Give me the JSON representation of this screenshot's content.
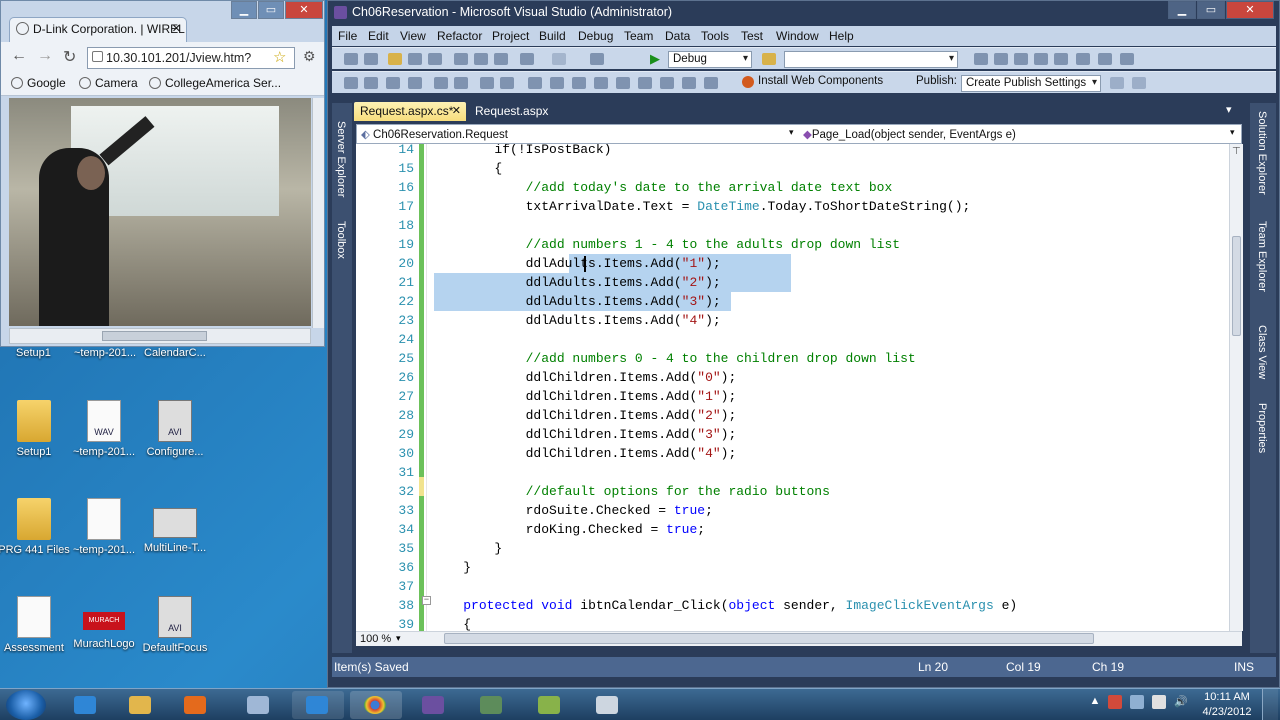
{
  "desktop": {
    "top_partial_labels": [
      "Setup1",
      "~temp-201...",
      "CalendarC..."
    ],
    "icons": [
      {
        "label": "Setup1",
        "icon": "folder-icon"
      },
      {
        "label": "~temp-201...",
        "icon": "wav-file-icon",
        "badge": "WAV"
      },
      {
        "label": "Configure...",
        "icon": "avi-file-icon",
        "badge": "AVI"
      },
      {
        "label": "PRG 441 Files",
        "icon": "folder-icon"
      },
      {
        "label": "~temp-201...",
        "icon": "file-icon"
      },
      {
        "label": "MultiLine-T...",
        "icon": "video-file-icon"
      },
      {
        "label": "Assessment",
        "icon": "document-icon"
      },
      {
        "label": "MurachLogo",
        "icon": "image-icon",
        "badge": "MURACH"
      },
      {
        "label": "DefaultFocus",
        "icon": "avi-file-icon",
        "badge": "AVI"
      }
    ]
  },
  "chrome": {
    "tab_title": "D-Link Corporation. | WIREL",
    "url": "10.30.101.201/Jview.htm?",
    "bookmarks": [
      "Google",
      "Camera",
      "CollegeAmerica Ser..."
    ]
  },
  "vs": {
    "window_title": "Ch06Reservation - Microsoft Visual Studio (Administrator)",
    "menu": [
      "File",
      "Edit",
      "View",
      "Refactor",
      "Project",
      "Build",
      "Debug",
      "Team",
      "Data",
      "Tools",
      "Test",
      "Window",
      "Help"
    ],
    "config_combo": "Debug",
    "install_label": "Install Web Components",
    "publish_label": "Publish:",
    "publish_combo": "Create Publish Settings",
    "tabs": [
      "Request.aspx.cs*",
      "Request.aspx"
    ],
    "left_panels": [
      "Server Explorer",
      "Toolbox"
    ],
    "right_panels": [
      "Solution Explorer",
      "Team Explorer",
      "Class View",
      "Properties"
    ],
    "nav_class": "Ch06Reservation.Request",
    "nav_member": "Page_Load(object sender, EventArgs e)",
    "zoom": "100 %",
    "code_lines": [
      {
        "n": "14",
        "indent": 8,
        "parts": [
          [
            "if(!IsPostBack)",
            "pl"
          ]
        ]
      },
      {
        "n": "15",
        "indent": 8,
        "parts": [
          [
            "{",
            "pl"
          ]
        ]
      },
      {
        "n": "16",
        "indent": 12,
        "parts": [
          [
            "//add today's date to the arrival date text box",
            "cm"
          ]
        ]
      },
      {
        "n": "17",
        "indent": 12,
        "parts": [
          [
            "txtArrivalDate.Text = ",
            "pl"
          ],
          [
            "DateTime",
            "ty"
          ],
          [
            ".Today.ToShortDateString();",
            "pl"
          ]
        ]
      },
      {
        "n": "18",
        "indent": 0,
        "parts": []
      },
      {
        "n": "19",
        "indent": 12,
        "parts": [
          [
            "//add numbers 1 - 4 to the adults drop down list",
            "cm"
          ]
        ]
      },
      {
        "n": "20",
        "indent": 12,
        "parts": [
          [
            "ddlAdults.Items.Add(",
            "pl"
          ],
          [
            "\"1\"",
            "st"
          ],
          [
            ");",
            "pl"
          ]
        ]
      },
      {
        "n": "21",
        "indent": 12,
        "parts": [
          [
            "ddlAdults.Items.Add(",
            "pl"
          ],
          [
            "\"2\"",
            "st"
          ],
          [
            ");",
            "pl"
          ]
        ]
      },
      {
        "n": "22",
        "indent": 12,
        "parts": [
          [
            "ddlAdults.Items.Add(",
            "pl"
          ],
          [
            "\"3\"",
            "st"
          ],
          [
            ");",
            "pl"
          ]
        ]
      },
      {
        "n": "23",
        "indent": 12,
        "parts": [
          [
            "ddlAdults.Items.Add(",
            "pl"
          ],
          [
            "\"4\"",
            "st"
          ],
          [
            ");",
            "pl"
          ]
        ]
      },
      {
        "n": "24",
        "indent": 0,
        "parts": []
      },
      {
        "n": "25",
        "indent": 12,
        "parts": [
          [
            "//add numbers 0 - 4 to the children drop down list",
            "cm"
          ]
        ]
      },
      {
        "n": "26",
        "indent": 12,
        "parts": [
          [
            "ddlChildren.Items.Add(",
            "pl"
          ],
          [
            "\"0\"",
            "st"
          ],
          [
            ");",
            "pl"
          ]
        ]
      },
      {
        "n": "27",
        "indent": 12,
        "parts": [
          [
            "ddlChildren.Items.Add(",
            "pl"
          ],
          [
            "\"1\"",
            "st"
          ],
          [
            ");",
            "pl"
          ]
        ]
      },
      {
        "n": "28",
        "indent": 12,
        "parts": [
          [
            "ddlChildren.Items.Add(",
            "pl"
          ],
          [
            "\"2\"",
            "st"
          ],
          [
            ");",
            "pl"
          ]
        ]
      },
      {
        "n": "29",
        "indent": 12,
        "parts": [
          [
            "ddlChildren.Items.Add(",
            "pl"
          ],
          [
            "\"3\"",
            "st"
          ],
          [
            ");",
            "pl"
          ]
        ]
      },
      {
        "n": "30",
        "indent": 12,
        "parts": [
          [
            "ddlChildren.Items.Add(",
            "pl"
          ],
          [
            "\"4\"",
            "st"
          ],
          [
            ");",
            "pl"
          ]
        ]
      },
      {
        "n": "31",
        "indent": 0,
        "parts": []
      },
      {
        "n": "32",
        "indent": 12,
        "parts": [
          [
            "//default options for the radio buttons",
            "cm"
          ]
        ]
      },
      {
        "n": "33",
        "indent": 12,
        "parts": [
          [
            "rdoSuite.Checked = ",
            "pl"
          ],
          [
            "true",
            "kw"
          ],
          [
            ";",
            "pl"
          ]
        ]
      },
      {
        "n": "34",
        "indent": 12,
        "parts": [
          [
            "rdoKing.Checked = ",
            "pl"
          ],
          [
            "true",
            "kw"
          ],
          [
            ";",
            "pl"
          ]
        ]
      },
      {
        "n": "35",
        "indent": 8,
        "parts": [
          [
            "}",
            "pl"
          ]
        ]
      },
      {
        "n": "36",
        "indent": 4,
        "parts": [
          [
            "}",
            "pl"
          ]
        ]
      },
      {
        "n": "37",
        "indent": 0,
        "parts": []
      },
      {
        "n": "38",
        "indent": 4,
        "parts": [
          [
            "protected",
            "kw"
          ],
          [
            " ",
            "pl"
          ],
          [
            "void",
            "kw"
          ],
          [
            " ibtnCalendar_Click(",
            "pl"
          ],
          [
            "object",
            "kw"
          ],
          [
            " sender, ",
            "pl"
          ],
          [
            "ImageClickEventArgs",
            "ty"
          ],
          [
            " e)",
            "pl"
          ]
        ]
      },
      {
        "n": "39",
        "indent": 4,
        "parts": [
          [
            "{",
            "pl"
          ]
        ]
      }
    ],
    "status": {
      "message": "Item(s) Saved",
      "ln": "Ln 20",
      "col": "Col 19",
      "ch": "Ch 19",
      "mode": "INS"
    }
  },
  "taskbar": {
    "time": "10:11 AM",
    "date": "4/23/2012"
  },
  "colors": {
    "keyword": "#0000ff",
    "type": "#2b91af",
    "comment": "#008000",
    "string": "#a31515",
    "selection": "#b5d3ef"
  }
}
